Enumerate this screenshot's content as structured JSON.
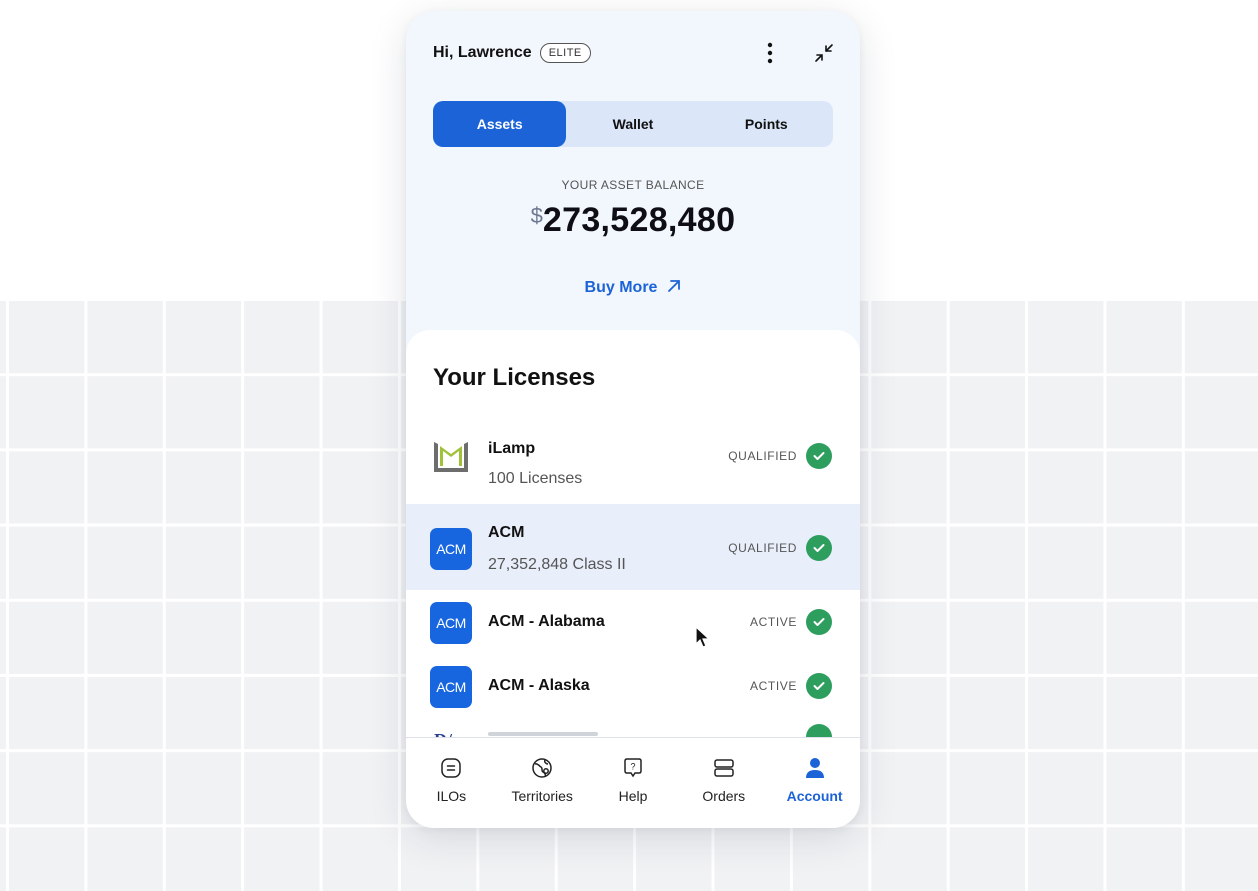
{
  "header": {
    "greeting": "Hi, Lawrence",
    "tier_badge": "ELITE",
    "menu_icon": "more-vertical-icon",
    "minimize_icon": "collapse-icon"
  },
  "tabs": [
    {
      "label": "Assets",
      "active": true
    },
    {
      "label": "Wallet",
      "active": false
    },
    {
      "label": "Points",
      "active": false
    }
  ],
  "balance": {
    "label": "YOUR ASSET BALANCE",
    "currency": "$",
    "amount": "273,528,480"
  },
  "buy_more": {
    "label": "Buy More",
    "icon": "arrow-up-right-icon"
  },
  "licenses": {
    "title": "Your Licenses",
    "items": [
      {
        "name": "iLamp",
        "subtitle": "100 Licenses",
        "status": "QUALIFIED",
        "logo": "ilamp-logo",
        "highlighted": false
      },
      {
        "name": "ACM",
        "subtitle": "27,352,848 Class II",
        "status": "QUALIFIED",
        "logo": "ACM",
        "highlighted": true
      },
      {
        "name": "ACM - Alabama",
        "subtitle": "",
        "status": "ACTIVE",
        "logo": "ACM",
        "highlighted": false
      },
      {
        "name": "ACM - Alaska",
        "subtitle": "",
        "status": "ACTIVE",
        "logo": "ACM",
        "highlighted": false
      }
    ]
  },
  "bottom_nav": [
    {
      "label": "ILOs",
      "icon": "list-icon",
      "active": false
    },
    {
      "label": "Territories",
      "icon": "globe-icon",
      "active": false
    },
    {
      "label": "Help",
      "icon": "help-bubble-icon",
      "active": false
    },
    {
      "label": "Orders",
      "icon": "orders-icon",
      "active": false
    },
    {
      "label": "Account",
      "icon": "user-icon",
      "active": true
    }
  ],
  "colors": {
    "accent": "#1d63d8",
    "success": "#2e9e5f",
    "panel_bg": "#f2f6fd",
    "highlight_row": "#e8eefa"
  }
}
